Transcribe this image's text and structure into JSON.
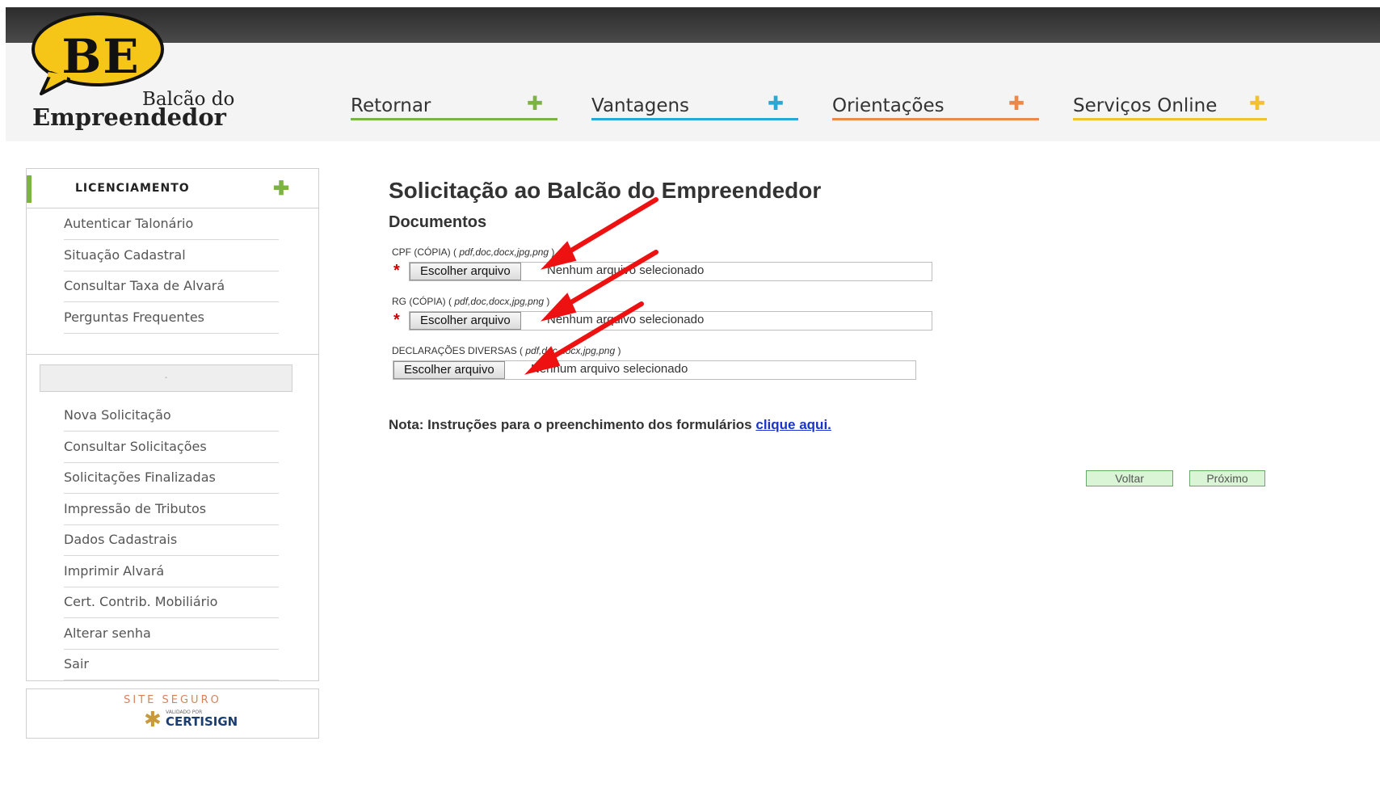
{
  "header": {
    "logo_mark": "BE",
    "logo_line1": "Balcão do",
    "logo_line2": "Empreendedor",
    "nav": [
      {
        "label": "Retornar",
        "color": "#7cb342"
      },
      {
        "label": "Vantagens",
        "color": "#29a8d8"
      },
      {
        "label": "Orientações",
        "color": "#e98a4a"
      },
      {
        "label": "Serviços Online",
        "color": "#f2c12e"
      }
    ],
    "logo_color": "#f5c518"
  },
  "sidebar": {
    "title": "LICENCIAMENTO",
    "group1": [
      "Autenticar Talonário",
      "Situação Cadastral",
      "Consultar Taxa de Alvará",
      "Perguntas Frequentes"
    ],
    "box_text": "-",
    "group2": [
      "Nova Solicitação",
      "Consultar Solicitações",
      "Solicitações Finalizadas",
      "Impressão de Tributos",
      "Dados Cadastrais",
      "Imprimir Alvará",
      "Cert. Contrib. Mobiliário",
      "Alterar senha",
      "Sair"
    ],
    "seal": {
      "line1": "SITE SEGURO",
      "line2": "VALIDADO POR",
      "line3": "CERTISIGN"
    }
  },
  "main": {
    "title": "Solicitação ao Balcão do Empreendedor",
    "section": "Documentos",
    "fields": [
      {
        "label": "CPF (CÓPIA) ( ",
        "hint": "pdf,doc,docx,jpg,png",
        "suffix": " )",
        "required": "*",
        "button": "Escolher arquivo",
        "status": "Nenhum arquivo selecionado"
      },
      {
        "label": "RG (CÓPIA) ( ",
        "hint": "pdf,doc,docx,jpg,png",
        "suffix": " )",
        "required": "*",
        "button": "Escolher arquivo",
        "status": "Nenhum arquivo selecionado"
      },
      {
        "label": "DECLARAÇÕES DIVERSAS ( ",
        "hint": "pdf,doc,docx,jpg,png",
        "suffix": " )",
        "required": "",
        "button": "Escolher arquivo",
        "status": "Nenhum arquivo selecionado"
      }
    ],
    "note_prefix": "Nota: Instruções para o preenchimento dos formulários ",
    "note_link": "clique aqui.",
    "back_button": "Voltar",
    "next_button": "Próximo"
  },
  "annotation_color": "#ee1111"
}
